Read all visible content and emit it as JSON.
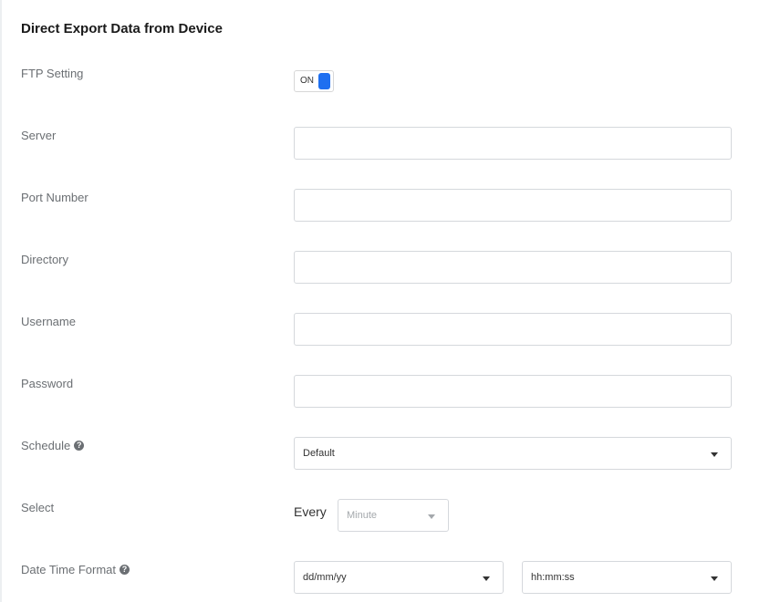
{
  "page": {
    "title": "Direct Export Data from Device"
  },
  "form": {
    "ftp_setting": {
      "label": "FTP Setting",
      "toggle_text": "ON",
      "enabled": true
    },
    "server": {
      "label": "Server",
      "value": ""
    },
    "port_number": {
      "label": "Port Number",
      "value": ""
    },
    "directory": {
      "label": "Directory",
      "value": ""
    },
    "username": {
      "label": "Username",
      "value": ""
    },
    "password": {
      "label": "Password",
      "value": ""
    },
    "schedule": {
      "label": "Schedule",
      "help_icon": "question-circle-icon",
      "selected": "Default"
    },
    "select": {
      "label": "Select",
      "every_text": "Every",
      "unit_selected": "Minute"
    },
    "date_time_format": {
      "label": "Date Time Format",
      "help_icon": "question-circle-icon",
      "date_selected": "dd/mm/yy",
      "time_selected": "hh:mm:ss"
    }
  },
  "colors": {
    "accent": "#1e6ff0",
    "label": "#6b6f73",
    "border": "#d5d8dc"
  }
}
